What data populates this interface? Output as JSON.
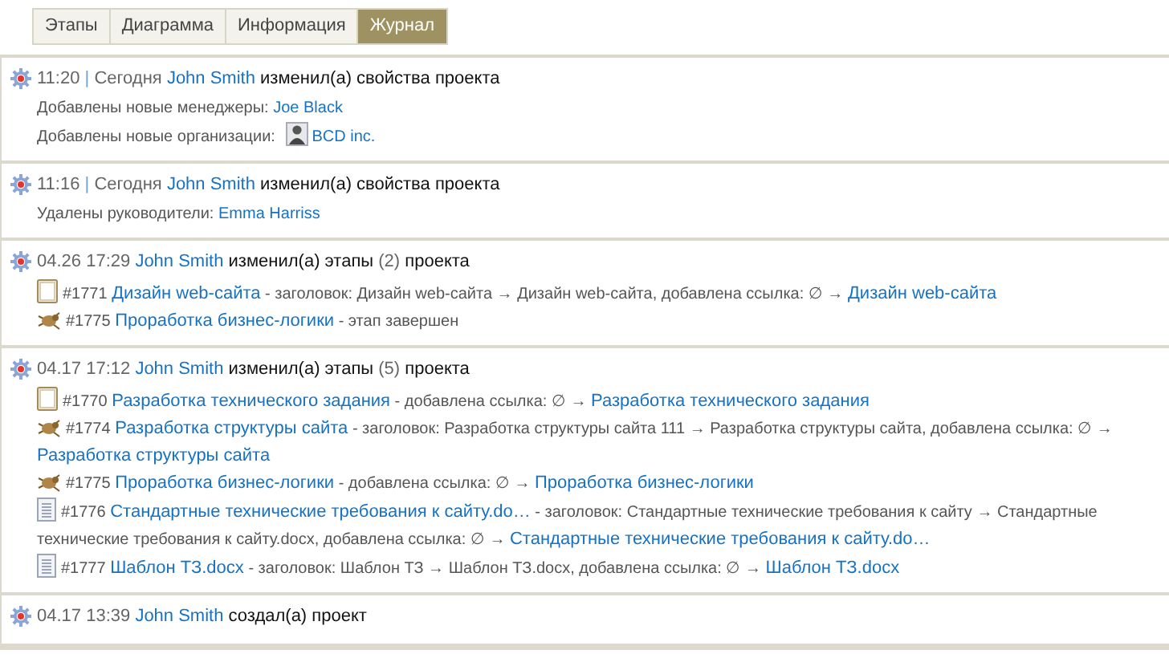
{
  "tabs": [
    {
      "label": "Этапы",
      "selected": false
    },
    {
      "label": "Диаграмма",
      "selected": false
    },
    {
      "label": "Информация",
      "selected": false
    },
    {
      "label": "Журнал",
      "selected": true
    }
  ],
  "entries": [
    {
      "time": "11:20",
      "separator": "|",
      "day": "Сегодня",
      "user": "John Smith",
      "action": "изменил(а) свойства проекта",
      "lines": [
        {
          "kind": "property",
          "label": "Добавлены новые менеджеры:",
          "value": "Joe Black"
        },
        {
          "kind": "organization",
          "label": "Добавлены новые организации:",
          "value": "BCD inc."
        }
      ]
    },
    {
      "time": "11:16",
      "separator": "|",
      "day": "Сегодня",
      "user": "John Smith",
      "action": "изменил(а) свойства проекта",
      "lines": [
        {
          "kind": "property",
          "label": "Удалены руководители:",
          "value": "Emma Harriss"
        }
      ]
    },
    {
      "time": "04.26 17:29",
      "user": "John Smith",
      "action": "изменил(а) этапы",
      "count": "(2)",
      "action_end": "проекта",
      "lines": [
        {
          "kind": "task",
          "number": "#1771",
          "title": "Дизайн web-сайта",
          "detail": "- заголовок: Дизайн web-сайта → Дизайн web-сайта, добавлена ссылка: ∅ →",
          "target": "Дизайн web-сайта"
        },
        {
          "kind": "bug",
          "number": "#1775",
          "title": "Проработка бизнес-логики",
          "detail": "- этап завершен"
        }
      ]
    },
    {
      "time": "04.17 17:12",
      "user": "John Smith",
      "action": "изменил(а) этапы",
      "count": "(5)",
      "action_end": "проекта",
      "lines": [
        {
          "kind": "task",
          "number": "#1770",
          "title": "Разработка технического задания",
          "detail": "- добавлена ссылка: ∅ →",
          "target": "Разработка технического задания"
        },
        {
          "kind": "bug",
          "number": "#1774",
          "title": "Разработка структуры сайта",
          "detail": "- заголовок: Разработка структуры сайта 111 → Разработка структуры сайта, добавлена ссылка: ∅ →",
          "target": "Разработка структуры сайта"
        },
        {
          "kind": "bug",
          "number": "#1775",
          "title": "Проработка бизнес-логики",
          "detail": "- добавлена ссылка: ∅ →",
          "target": "Проработка бизнес-логики"
        },
        {
          "kind": "doc",
          "number": "#1776",
          "title": "Стандартные технические требования к сайту.do…",
          "detail": "- заголовок: Стандартные технические требования к сайту → Стандартные технические требования к сайту.docx, добавлена ссылка: ∅ →",
          "target": "Стандартные технические требования к сайту.do…"
        },
        {
          "kind": "doc",
          "number": "#1777",
          "title": "Шаблон ТЗ.docx",
          "detail": "- заголовок: Шаблон ТЗ → Шаблон ТЗ.docx, добавлена ссылка: ∅ →",
          "target": "Шаблон ТЗ.docx"
        }
      ]
    },
    {
      "time": "04.17 13:39",
      "user": "John Smith",
      "action": "создал(а) проект"
    }
  ]
}
